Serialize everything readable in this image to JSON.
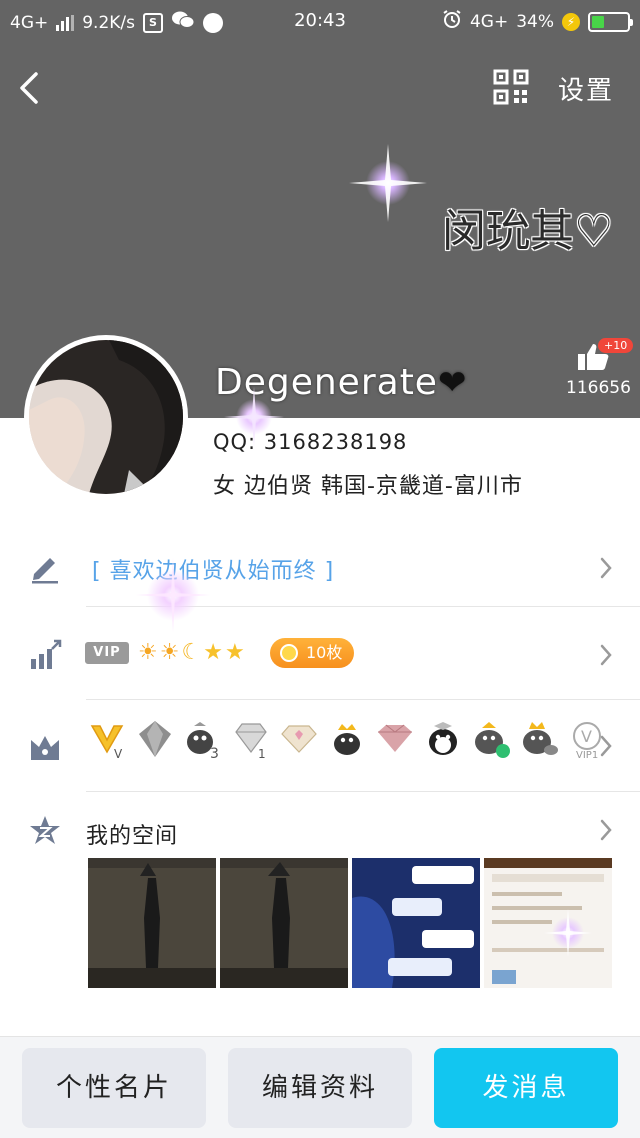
{
  "status_bar": {
    "network": "4G+",
    "speed": "9.2K/s",
    "time": "20:43",
    "network_right": "4G+",
    "battery": "34%"
  },
  "header": {
    "settings_label": "设置",
    "nickname_art": "闵玧其♡",
    "username": "Degenerate",
    "heart": "❤",
    "like_badge": "+10",
    "like_count": "116656"
  },
  "profile": {
    "qq": "QQ: 3168238198",
    "info": "女 边伯贤 韩国-京畿道-富川市"
  },
  "rows": {
    "signature": "[ 喜欢边伯贤从始而终 ]",
    "vip_label": "VIP",
    "level_icons": [
      "☀",
      "☀",
      "☾",
      "★",
      "★"
    ],
    "coin_label": "10枚",
    "space_title": "我的空间"
  },
  "badges": [
    "V",
    "◆",
    "3",
    "◇",
    "◇",
    "●",
    "◆",
    "●",
    "●",
    "●",
    "V"
  ],
  "bottom": {
    "card_label": "个性名片",
    "edit_label": "编辑资料",
    "message_label": "发消息"
  },
  "colors": {
    "header_bg": "#646464",
    "accent_blue": "#12c6f0",
    "signature_blue": "#57a3e8",
    "coin_orange": "#f7901e",
    "icon_gray": "#6f7b93"
  }
}
